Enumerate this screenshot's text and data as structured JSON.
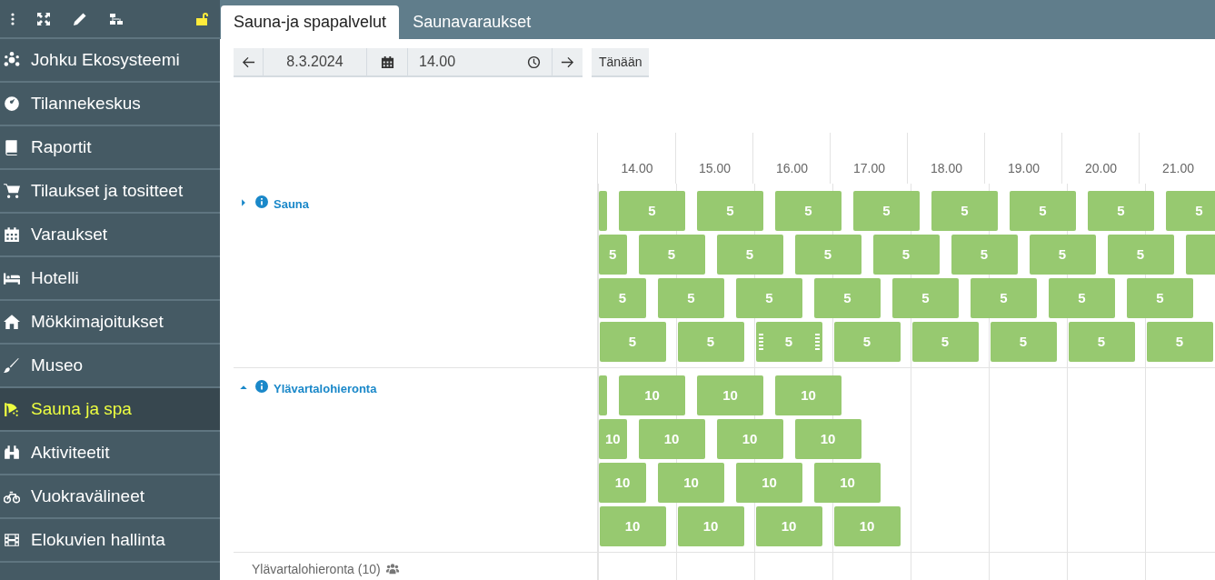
{
  "sidebar": {
    "toolbar": [
      {
        "kind": "dots"
      },
      {
        "kind": "expand"
      },
      {
        "kind": "pencil"
      },
      {
        "kind": "sitemap"
      },
      {
        "kind": "lock"
      }
    ],
    "items": [
      {
        "label": "Johku Ekosysteemi",
        "selected": false
      },
      {
        "label": "Tilannekeskus",
        "selected": false
      },
      {
        "label": "Raportit",
        "selected": false
      },
      {
        "label": "Tilaukset ja tositteet",
        "selected": false
      },
      {
        "label": "Varaukset",
        "selected": false
      },
      {
        "label": "Hotelli",
        "selected": false
      },
      {
        "label": "Mökkimajoitukset",
        "selected": false
      },
      {
        "label": "Museo",
        "selected": false
      },
      {
        "label": "Sauna ja spa",
        "selected": true
      },
      {
        "label": "Aktiviteetit",
        "selected": false
      },
      {
        "label": "Vuokravälineet",
        "selected": false
      },
      {
        "label": "Elokuvien hallinta",
        "selected": false
      }
    ]
  },
  "tabs": [
    {
      "label": "Sauna-ja spapalvelut",
      "selected": true
    },
    {
      "label": "Saunavaraukset",
      "selected": false
    }
  ],
  "toolbar": {
    "date": "8.3.2024",
    "time": "14.00",
    "today_button": "Tänään"
  },
  "timeline": {
    "hours": [
      "14.00",
      "15.00",
      "16.00",
      "17.00",
      "18.00",
      "19.00",
      "20.00",
      "21.00"
    ],
    "resources": [
      {
        "name": "Sauna",
        "expanded": false,
        "lanes": [
          {
            "blocks": [
              {
                "kind": "cut",
                "handles": false
              },
              {
                "kind": "booking",
                "label": "5",
                "handles": false
              },
              {
                "kind": "booking",
                "label": "5",
                "handles": false
              },
              {
                "kind": "booking",
                "label": "5",
                "handles": false
              },
              {
                "kind": "booking",
                "label": "5",
                "handles": false
              },
              {
                "kind": "booking",
                "label": "5",
                "handles": false
              },
              {
                "kind": "booking",
                "label": "5",
                "handles": false
              },
              {
                "kind": "booking",
                "label": "5",
                "handles": false
              },
              {
                "kind": "booking",
                "label": "5",
                "handles": false
              }
            ]
          },
          {
            "blocks": [
              {
                "kind": "booking",
                "label": "5",
                "handles": false
              },
              {
                "kind": "booking",
                "label": "5",
                "handles": false
              },
              {
                "kind": "booking",
                "label": "5",
                "handles": false
              },
              {
                "kind": "booking",
                "label": "5",
                "handles": false
              },
              {
                "kind": "booking",
                "label": "5",
                "handles": false
              },
              {
                "kind": "booking",
                "label": "5",
                "handles": false
              },
              {
                "kind": "booking",
                "label": "5",
                "handles": false
              },
              {
                "kind": "booking",
                "label": "5",
                "handles": false
              },
              {
                "kind": "cut",
                "handles": false
              }
            ]
          },
          {
            "blocks": [
              {
                "kind": "booking",
                "label": "5",
                "handles": false
              },
              {
                "kind": "booking",
                "label": "5",
                "handles": false
              },
              {
                "kind": "booking",
                "label": "5",
                "handles": false
              },
              {
                "kind": "booking",
                "label": "5",
                "handles": false
              },
              {
                "kind": "booking",
                "label": "5",
                "handles": false
              },
              {
                "kind": "booking",
                "label": "5",
                "handles": false
              },
              {
                "kind": "booking",
                "label": "5",
                "handles": false
              },
              {
                "kind": "booking",
                "label": "5",
                "handles": false
              }
            ]
          },
          {
            "blocks": [
              {
                "kind": "booking",
                "label": "5",
                "handles": false
              },
              {
                "kind": "booking",
                "label": "5",
                "handles": false
              },
              {
                "kind": "booking",
                "label": "5",
                "handles": true
              },
              {
                "kind": "booking",
                "label": "5",
                "handles": false
              },
              {
                "kind": "booking",
                "label": "5",
                "handles": false
              },
              {
                "kind": "booking",
                "label": "5",
                "handles": false
              },
              {
                "kind": "booking",
                "label": "5",
                "handles": false
              },
              {
                "kind": "booking",
                "label": "5",
                "handles": false
              }
            ]
          }
        ]
      },
      {
        "name": "Ylävartalohieronta",
        "expanded": true,
        "lanes": [
          {
            "blocks": [
              {
                "kind": "cut",
                "handles": false
              },
              {
                "kind": "booking",
                "label": "10",
                "handles": false
              },
              {
                "kind": "booking",
                "label": "10",
                "handles": false
              },
              {
                "kind": "booking",
                "label": "10",
                "handles": false
              }
            ]
          },
          {
            "blocks": [
              {
                "kind": "booking",
                "label": "10",
                "handles": false
              },
              {
                "kind": "booking",
                "label": "10",
                "handles": false
              },
              {
                "kind": "booking",
                "label": "10",
                "handles": false
              },
              {
                "kind": "booking",
                "label": "10",
                "handles": false
              }
            ]
          },
          {
            "blocks": [
              {
                "kind": "booking",
                "label": "10",
                "handles": false
              },
              {
                "kind": "booking",
                "label": "10",
                "handles": false
              },
              {
                "kind": "booking",
                "label": "10",
                "handles": false
              },
              {
                "kind": "booking",
                "label": "10",
                "handles": false
              }
            ]
          },
          {
            "blocks": [
              {
                "kind": "booking",
                "label": "10",
                "handles": false
              },
              {
                "kind": "booking",
                "label": "10",
                "handles": false
              },
              {
                "kind": "booking",
                "label": "10",
                "handles": false
              },
              {
                "kind": "booking",
                "label": "10",
                "handles": false
              }
            ]
          }
        ]
      }
    ],
    "group_row": {
      "label": "Ylävartalohieronta (10)"
    }
  }
}
